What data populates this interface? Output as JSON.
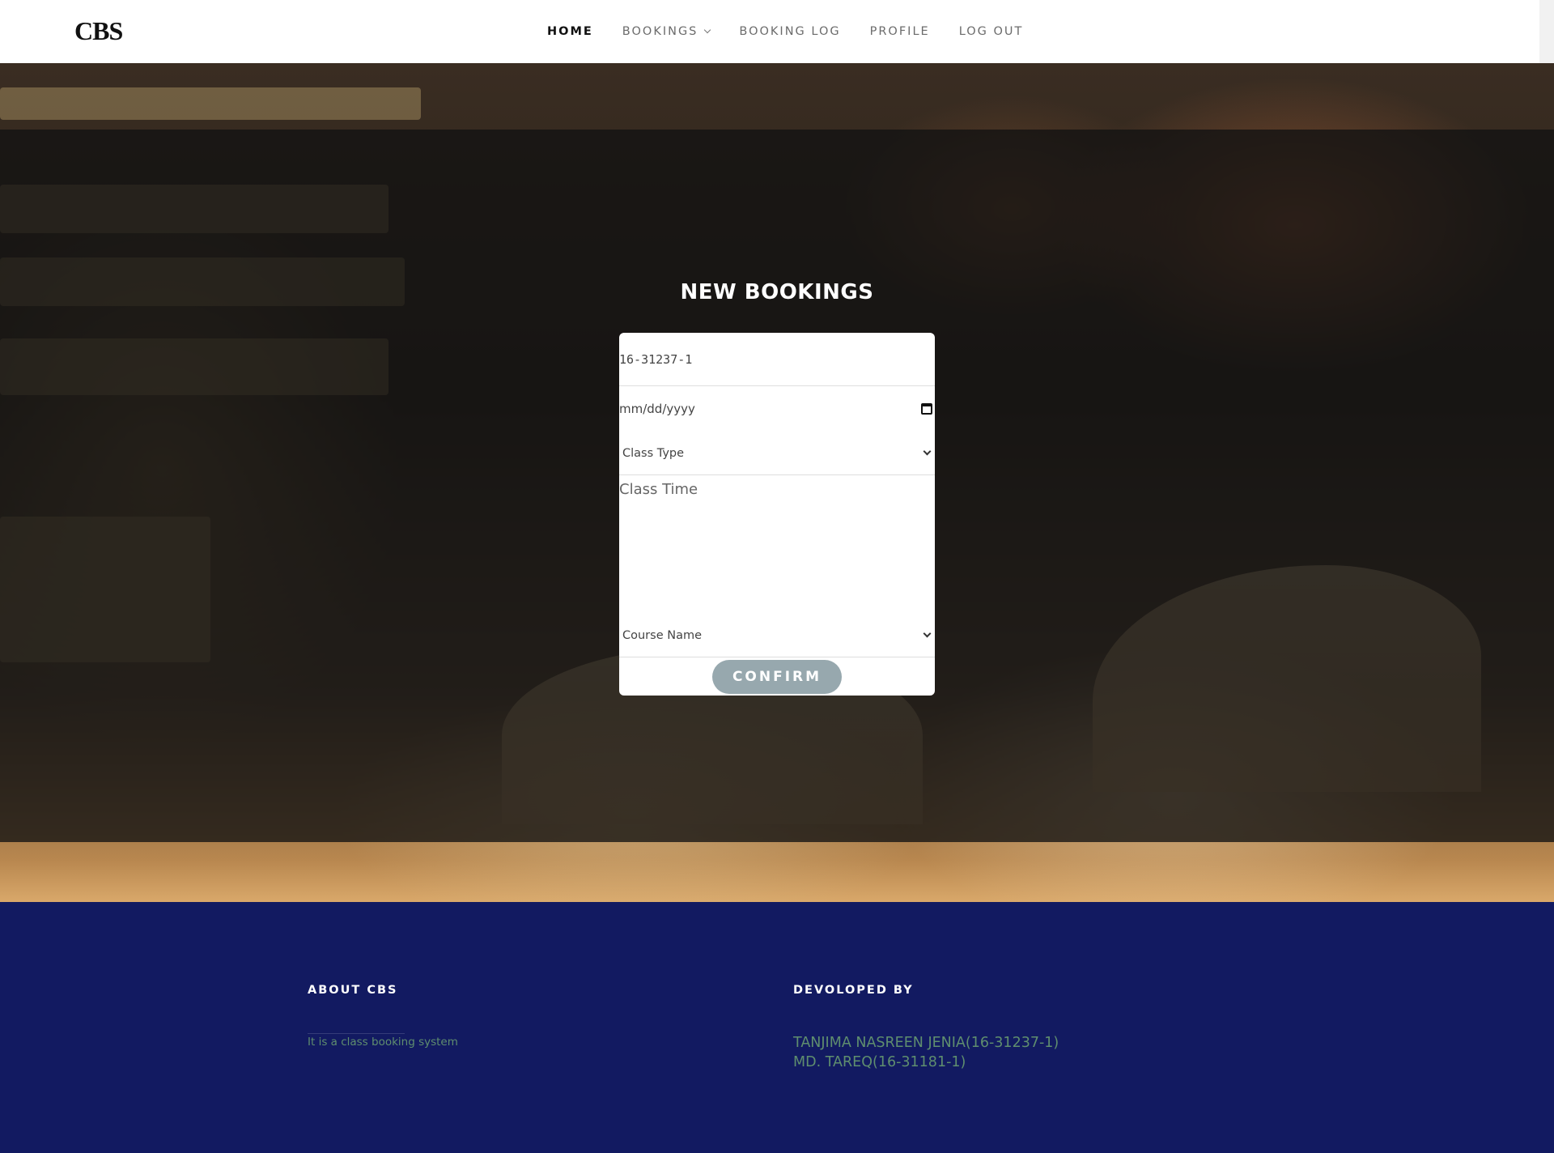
{
  "brand": "CBS",
  "nav": {
    "items": [
      {
        "label": "HOME"
      },
      {
        "label": "BOOKINGS"
      },
      {
        "label": "BOOKING LOG"
      },
      {
        "label": "PROFILE"
      },
      {
        "label": "LOG OUT"
      }
    ],
    "active": "HOME"
  },
  "form": {
    "title": "NEW BOOKINGS",
    "student_id_value": "16-31237-1",
    "date_placeholder": "mm/dd/yyyy",
    "class_type_selected": "Class Type",
    "class_time_placeholder": "Class Time",
    "course_name_selected": "Course Name",
    "confirm_label": "CONFIRM"
  },
  "footer": {
    "about_heading": "ABOUT CBS",
    "about_text": "It is a class booking system",
    "developed_heading": "DEVOLOPED BY",
    "developers": [
      "TANJIMA NASREEN JENIA(16-31237-1)",
      "MD. TAREQ(16-31181-1)"
    ]
  },
  "colors": {
    "footer_bg": "#121a61",
    "footer_text_accent": "#5f8e6e",
    "button_bg": "#97a8ae"
  },
  "icons": {
    "date": "calendar-icon",
    "select": "chevron-down-icon",
    "nav_dropdown": "chevron-down-icon"
  }
}
